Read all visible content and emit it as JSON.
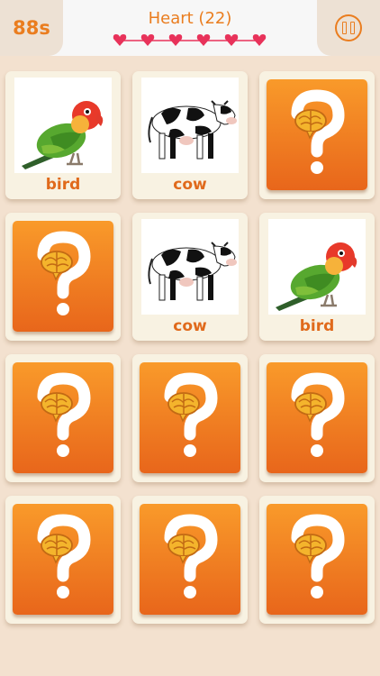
{
  "header": {
    "timer": "88s",
    "title": "Heart (22)",
    "hearts_count": 6,
    "pause_icon": "pause-icon"
  },
  "colors": {
    "accent": "#ea7d1f",
    "background": "#f3e1cf",
    "card_face": "#f8f2e2",
    "card_back": "#f08a24",
    "heart": "#e8325a"
  },
  "cards": [
    {
      "state": "revealed",
      "label": "bird",
      "icon": "bird-image"
    },
    {
      "state": "revealed",
      "label": "cow",
      "icon": "cow-image"
    },
    {
      "state": "hidden",
      "icon": "question-brain-icon"
    },
    {
      "state": "hidden",
      "icon": "question-brain-icon"
    },
    {
      "state": "revealed",
      "label": "cow",
      "icon": "cow-image"
    },
    {
      "state": "revealed",
      "label": "bird",
      "icon": "bird-image"
    },
    {
      "state": "hidden",
      "icon": "question-brain-icon"
    },
    {
      "state": "hidden",
      "icon": "question-brain-icon"
    },
    {
      "state": "hidden",
      "icon": "question-brain-icon"
    },
    {
      "state": "hidden",
      "icon": "question-brain-icon"
    },
    {
      "state": "hidden",
      "icon": "question-brain-icon"
    },
    {
      "state": "hidden",
      "icon": "question-brain-icon"
    }
  ]
}
